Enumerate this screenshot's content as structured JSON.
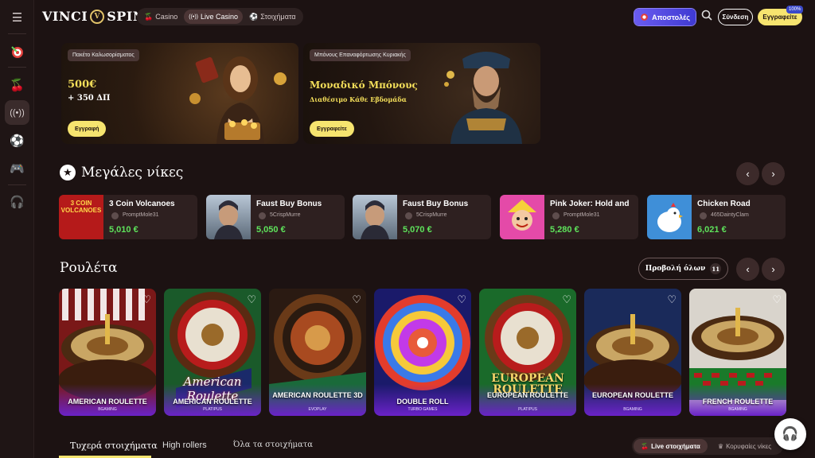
{
  "brand": {
    "name_left": "VINCI",
    "name_right": "SPIN",
    "mark": "V"
  },
  "header": {
    "tabs": [
      {
        "label": "Casino",
        "icon": "cherries-icon"
      },
      {
        "label": "Live Casino",
        "icon": "broadcast-icon"
      },
      {
        "label": "Στοιχήματα",
        "icon": "football-icon"
      }
    ],
    "active_tab": "Live Casino",
    "promo_label": "Αποστολές",
    "login_label": "Σύνδεση",
    "signup_label": "Εγγραφείτε",
    "signup_badge": "100%"
  },
  "banners": [
    {
      "tag": "Πακέτο Καλωσορίσματος",
      "title": "500€",
      "subtitle": "+ 350 ΔΠ",
      "button": "Εγγραφή"
    },
    {
      "tag": "Μπόνους Επαναφόρτωσης Κυριακής",
      "title": "Μοναδικό Μπόνους",
      "subtitle": "Διαθέσιμο Κάθε Εβδομάδα",
      "button": "Εγγραφείτε"
    }
  ],
  "big_wins": {
    "title": "Μεγάλες νίκες",
    "items": [
      {
        "game": "3 Coin Volcanoes",
        "user": "PromptMole31",
        "amount": "5,010 €",
        "thumb_text": "3 COIN VOLCANOES"
      },
      {
        "game": "Faust Buy Bonus",
        "user": "5CrispMurre",
        "amount": "5,050 €"
      },
      {
        "game": "Faust Buy Bonus",
        "user": "5CrispMurre",
        "amount": "5,070 €"
      },
      {
        "game": "Pink Joker: Hold and",
        "user": "PromptMole31",
        "amount": "5,280 €"
      },
      {
        "game": "Chicken Road",
        "user": "465DaintyClam",
        "amount": "6,021 €"
      }
    ]
  },
  "roulette": {
    "title": "Ρουλέτα",
    "view_all": "Προβολή όλων",
    "count": "11",
    "games": [
      {
        "name": "AMERICAN ROULETTE",
        "provider": "BGAMING"
      },
      {
        "name": "AMERICAN ROULETTE",
        "provider": "PLATIPUS",
        "art_text": "American Roulette"
      },
      {
        "name": "AMERICAN ROULETTE 3D",
        "provider": "EVOPLAY"
      },
      {
        "name": "DOUBLE ROLL",
        "provider": "TURBO GAMES"
      },
      {
        "name": "EUROPEAN ROULETTE",
        "provider": "PLATIPUS",
        "art_text": "EUROPEAN ROULETTE"
      },
      {
        "name": "EUROPEAN ROULETTE",
        "provider": "BGAMING"
      },
      {
        "name": "FRENCH ROULETTE",
        "provider": "BGAMING"
      }
    ]
  },
  "bets": {
    "tabs": [
      "Τυχερά στοιχήματα",
      "High rollers",
      "Όλα τα στοιχήματα"
    ],
    "segments": [
      "Live στοιχήματα",
      "Κορυφαίες νίκες"
    ]
  },
  "colors": {
    "accent_yellow": "#f6e46f",
    "win_green": "#5ee35b",
    "promo_purple": "#5b4fe6",
    "bg": "#1c1212"
  }
}
